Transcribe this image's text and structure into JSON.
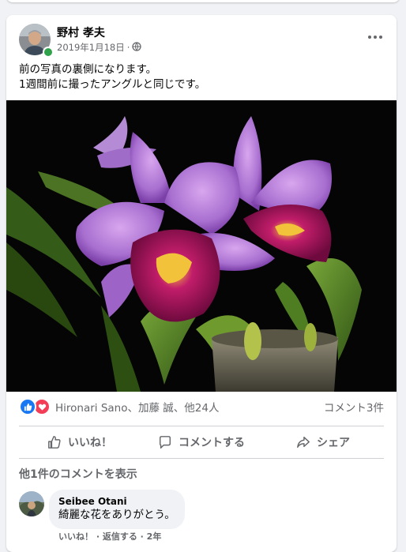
{
  "post": {
    "author": "野村 孝夫",
    "date": "2019年1月18日",
    "meta_sep": "·",
    "text_line1": "前の写真の裏側になります。",
    "text_line2": "1週間前に撮ったアングルと同じです。"
  },
  "reactions": {
    "names": "Hironari Sano、加藤 誠、他24人",
    "comment_count": "コメント3件",
    "icons": [
      "like-icon",
      "love-icon"
    ]
  },
  "actions": {
    "like": "いいね！",
    "comment": "コメントする",
    "share": "シェア"
  },
  "comments": {
    "view_more": "他1件のコメントを表示",
    "items": [
      {
        "name": "Seibee Otani",
        "text": "綺麗な花をありがとう。"
      }
    ],
    "footer": "いいね！ · 返信する · 2年"
  },
  "colors": {
    "brand_blue": "#1877f2",
    "love_red": "#f33e58",
    "online_green": "#31a24c",
    "muted_text": "#65676b"
  }
}
